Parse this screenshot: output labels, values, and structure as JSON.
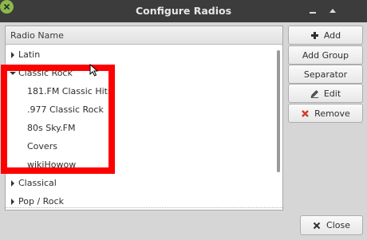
{
  "window": {
    "title": "Configure Radios"
  },
  "tree": {
    "column_header": "Radio Name",
    "rows": [
      {
        "label": "Latin",
        "expanded": false,
        "level": 0
      },
      {
        "label": "Classic Rock",
        "expanded": true,
        "level": 0
      },
      {
        "label": "181.FM Classic Hits",
        "level": 1
      },
      {
        "label": ".977 Classic Rock",
        "level": 1
      },
      {
        "label": "80s Sky.FM",
        "level": 1
      },
      {
        "label": "Covers",
        "level": 1
      },
      {
        "label": "wikiHowow",
        "level": 1
      },
      {
        "label": "Classical",
        "expanded": false,
        "level": 0
      },
      {
        "label": "Pop / Rock",
        "expanded": false,
        "level": 0
      }
    ]
  },
  "buttons": {
    "add": "Add",
    "add_group": "Add Group",
    "separator": "Separator",
    "edit": "Edit",
    "remove": "Remove",
    "close": "Close"
  },
  "colors": {
    "titlebar": "#3c3c3c",
    "close_button": "#8cb94a",
    "highlight": "#ff0000",
    "remove_icon": "#d23b2c"
  }
}
